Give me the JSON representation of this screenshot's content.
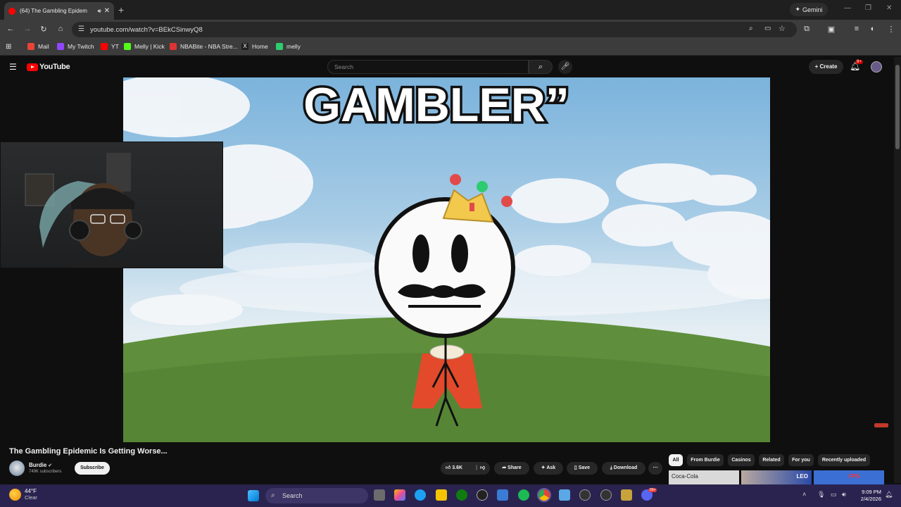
{
  "browser": {
    "tab_title": "(64) The Gambling Epidem",
    "tab_sound_icon": "speaker-icon",
    "close_glyph": "✕",
    "new_tab_glyph": "+",
    "gemini_label": "Gemini",
    "url": "youtube.com/watch?v=BEkCSinwyQ8",
    "bookmarks": [
      {
        "label": "Mail",
        "color": "#ea4335"
      },
      {
        "label": "My Twitch",
        "color": "#9146ff"
      },
      {
        "label": "YT",
        "color": "#ff0000"
      },
      {
        "label": "Melly | Kick",
        "color": "#53fc18"
      },
      {
        "label": "NBABite - NBA Stre...",
        "color": "#d33"
      },
      {
        "label": "Home",
        "color": "#ffffff"
      },
      {
        "label": "melly",
        "color": "#2ecc71"
      }
    ]
  },
  "youtube": {
    "logo_text": "YouTube",
    "search_placeholder": "Search",
    "create_label": "Create",
    "notification_badge": "9+",
    "video_title": "The Gambling Epidemic Is Getting Worse...",
    "channel_name": "Burdie",
    "channel_subscribers": "749K subscribers",
    "subscribe_label": "Subscribe",
    "like_count": "3.6K",
    "share_label": "Share",
    "ask_label": "Ask",
    "save_label": "Save",
    "download_label": "Download",
    "more_glyph": "⋯",
    "chips": [
      "All",
      "From Burdie",
      "Casinos",
      "Related",
      "For you",
      "Recently uploaded"
    ],
    "thumb_text": "Coca-Cola",
    "thumb_text_2": "LEO",
    "thumb_text_3": "FPS"
  },
  "video_frame": {
    "headline": "GAMBLER”",
    "sky_color": "#8fc0e2",
    "grass_color": "#5f8f3c"
  },
  "taskbar": {
    "temperature": "44°F",
    "weather": "Clear",
    "search_label": "Search",
    "time": "9:09 PM",
    "date": "2/4/2026",
    "discord_badge": "99+"
  },
  "colors": {
    "accent": "#ff0000",
    "taskbar": "#2a2350"
  }
}
